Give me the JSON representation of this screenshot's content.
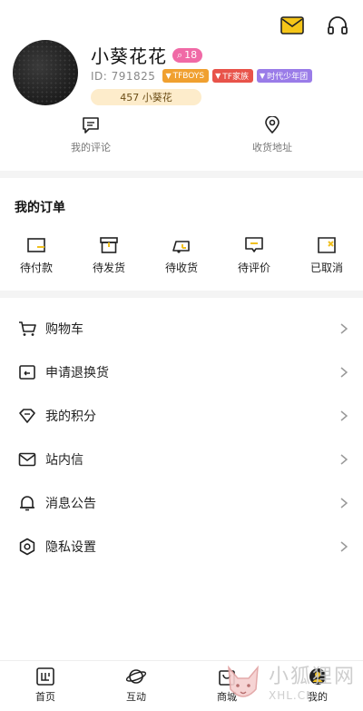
{
  "header": {
    "mail_icon": "mail-icon",
    "service_icon": "headset-icon",
    "accent_color": "#f0c020"
  },
  "profile": {
    "name": "小葵花花",
    "level": "18",
    "id_text": "ID: 791825",
    "tags": [
      {
        "label": "TFBOYS",
        "color": "#f0a030"
      },
      {
        "label": "TF家族",
        "color": "#e8534a"
      },
      {
        "label": "时代少年团",
        "color": "#9a7ce8"
      }
    ],
    "fans_label": "457 小葵花"
  },
  "quick_links": [
    {
      "label": "我的评论",
      "icon": "comment-icon"
    },
    {
      "label": "收货地址",
      "icon": "location-icon"
    }
  ],
  "orders": {
    "title": "我的订单",
    "items": [
      {
        "label": "待付款",
        "icon": "wallet-icon"
      },
      {
        "label": "待发货",
        "icon": "box-icon"
      },
      {
        "label": "待收货",
        "icon": "truck-icon"
      },
      {
        "label": "待评价",
        "icon": "review-icon"
      },
      {
        "label": "已取消",
        "icon": "cancelled-icon"
      }
    ]
  },
  "menu": [
    {
      "label": "购物车",
      "icon": "cart-icon"
    },
    {
      "label": "申请退换货",
      "icon": "return-icon"
    },
    {
      "label": "我的积分",
      "icon": "diamond-icon"
    },
    {
      "label": "站内信",
      "icon": "mail-icon"
    },
    {
      "label": "消息公告",
      "icon": "bell-icon"
    },
    {
      "label": "隐私设置",
      "icon": "gear-icon"
    }
  ],
  "tabbar": [
    {
      "label": "首页",
      "icon": "home-icon"
    },
    {
      "label": "互动",
      "icon": "planet-icon"
    },
    {
      "label": "商城",
      "icon": "bag-icon"
    },
    {
      "label": "我的",
      "icon": "profile-icon",
      "active": true
    }
  ],
  "watermark": {
    "cn": "小狐狸网",
    "en": "XHL.CN"
  }
}
